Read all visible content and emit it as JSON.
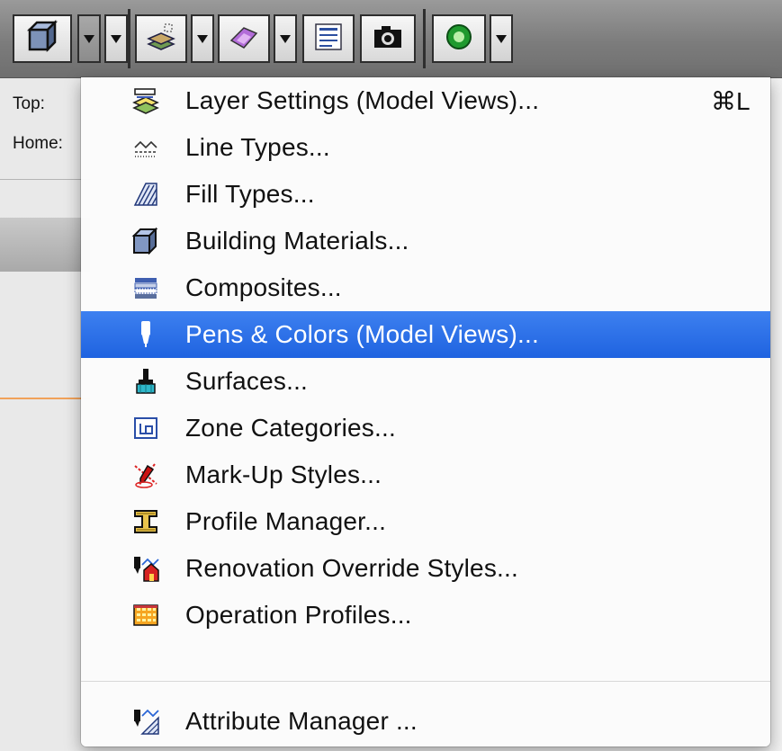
{
  "left_panel": {
    "top_label": "Top:",
    "home_label": "Home:"
  },
  "toolbar": {
    "buttons": [
      {
        "icon": "building-material-icon"
      },
      {
        "icon": "layer-settings-icon"
      },
      {
        "icon": "surface-icon"
      },
      {
        "icon": "text-document-icon"
      },
      {
        "icon": "camera-icon"
      },
      {
        "icon": "green-circle-icon"
      }
    ]
  },
  "menu": {
    "items": [
      {
        "label": "Layer Settings (Model Views)...",
        "shortcut": "⌘L",
        "icon": "layer-settings-icon"
      },
      {
        "label": "Line Types...",
        "icon": "line-types-icon"
      },
      {
        "label": "Fill Types...",
        "icon": "fill-types-icon"
      },
      {
        "label": "Building Materials...",
        "icon": "building-materials-icon"
      },
      {
        "label": "Composites...",
        "icon": "composites-icon"
      },
      {
        "label": "Pens & Colors (Model Views)...",
        "icon": "pen-icon",
        "highlighted": true
      },
      {
        "label": "Surfaces...",
        "icon": "surfaces-brush-icon"
      },
      {
        "label": "Zone Categories...",
        "icon": "zone-categories-icon"
      },
      {
        "label": "Mark-Up Styles...",
        "icon": "markup-styles-icon"
      },
      {
        "label": "Profile Manager...",
        "icon": "profile-manager-icon"
      },
      {
        "label": "Renovation Override Styles...",
        "icon": "renovation-override-icon"
      },
      {
        "label": "Operation Profiles...",
        "icon": "operation-profiles-icon"
      },
      {
        "label": "Attribute Manager ...",
        "icon": "attribute-manager-icon"
      }
    ]
  },
  "colors": {
    "highlight": "#2a6be6",
    "menu_background": "#fbfbfb",
    "toolbar": "#8a8a8a"
  }
}
